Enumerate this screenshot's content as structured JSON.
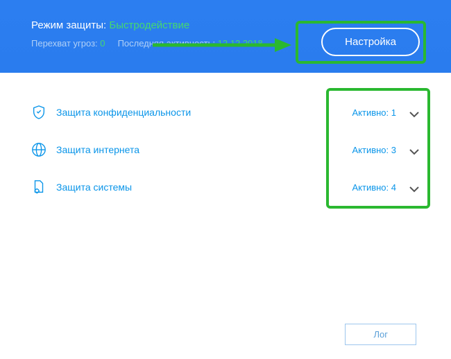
{
  "header": {
    "mode_label": "Режим защиты: ",
    "mode_value": "Быстродействие",
    "threats_label": "Перехват угроз: ",
    "threats_value": "0",
    "activity_label": "Последняя активность: ",
    "activity_value": "12.12.2018",
    "settings_button": "Настройка"
  },
  "sections": {
    "privacy": {
      "label": "Защита конфиденциальности",
      "status_label": "Активно: ",
      "status_value": "1"
    },
    "internet": {
      "label": "Защита интернета",
      "status_label": "Активно: ",
      "status_value": "3"
    },
    "system": {
      "label": "Защита системы",
      "status_label": "Активно: ",
      "status_value": "4"
    }
  },
  "footer": {
    "log_button": "Лог"
  },
  "colors": {
    "accent": "#0a95e9",
    "highlight": "#2ab830",
    "header_bg": "#2c7ef0",
    "green_text": "#45d970"
  }
}
